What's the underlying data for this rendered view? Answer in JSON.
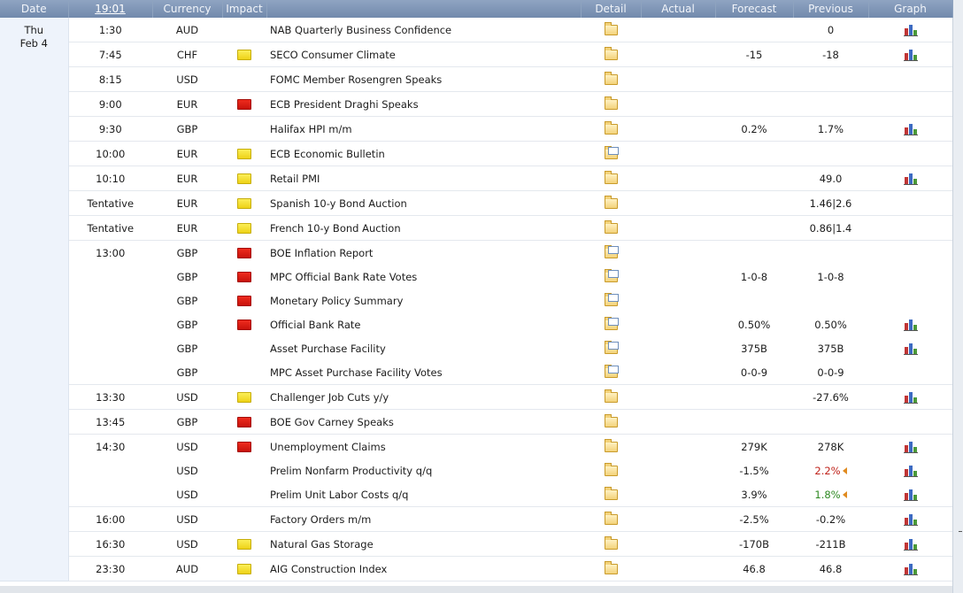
{
  "header": {
    "date": "Date",
    "time": "19:01",
    "currency": "Currency",
    "impact": "Impact",
    "event": "",
    "detail": "Detail",
    "actual": "Actual",
    "forecast": "Forecast",
    "previous": "Previous",
    "graph": "Graph"
  },
  "day": {
    "weekday": "Thu",
    "date": "Feb 4"
  },
  "colors": {
    "header_bg": "#7f95b6",
    "impact_high": "#dd1c12",
    "impact_medium": "#ee8a30",
    "impact_low": "#f5e03a",
    "prev_red": "#c0241c",
    "prev_green": "#2f8a23"
  },
  "rows": [
    {
      "time": "1:30",
      "currency": "AUD",
      "impact": "medium",
      "event": "NAB Quarterly Business Confidence",
      "detail_icon": "folder-icon",
      "actual": "",
      "forecast": "",
      "previous": "0",
      "previous_style": "",
      "graph": true,
      "group_end": true
    },
    {
      "time": "7:45",
      "currency": "CHF",
      "impact": "low",
      "event": "SECO Consumer Climate",
      "detail_icon": "folder-icon",
      "actual": "",
      "forecast": "-15",
      "previous": "-18",
      "previous_style": "",
      "graph": true,
      "group_end": true
    },
    {
      "time": "8:15",
      "currency": "USD",
      "impact": "medium",
      "event": "FOMC Member Rosengren Speaks",
      "detail_icon": "folder-icon",
      "actual": "",
      "forecast": "",
      "previous": "",
      "previous_style": "",
      "graph": false,
      "group_end": true
    },
    {
      "time": "9:00",
      "currency": "EUR",
      "impact": "high",
      "event": "ECB President Draghi Speaks",
      "detail_icon": "folder-icon",
      "actual": "",
      "forecast": "",
      "previous": "",
      "previous_style": "",
      "graph": false,
      "group_end": true
    },
    {
      "time": "9:30",
      "currency": "GBP",
      "impact": "medium",
      "event": "Halifax HPI m/m",
      "detail_icon": "folder-icon",
      "actual": "",
      "forecast": "0.2%",
      "previous": "1.7%",
      "previous_style": "",
      "graph": true,
      "group_end": true
    },
    {
      "time": "10:00",
      "currency": "EUR",
      "impact": "low",
      "event": "ECB Economic Bulletin",
      "detail_icon": "folder-doc-icon",
      "actual": "",
      "forecast": "",
      "previous": "",
      "previous_style": "",
      "graph": false,
      "group_end": true
    },
    {
      "time": "10:10",
      "currency": "EUR",
      "impact": "low",
      "event": "Retail PMI",
      "detail_icon": "folder-icon",
      "actual": "",
      "forecast": "",
      "previous": "49.0",
      "previous_style": "",
      "graph": true,
      "group_end": true
    },
    {
      "time": "Tentative",
      "currency": "EUR",
      "impact": "low",
      "event": "Spanish 10-y Bond Auction",
      "detail_icon": "folder-icon",
      "actual": "",
      "forecast": "",
      "previous": "1.46|2.6",
      "previous_style": "",
      "graph": false,
      "group_end": true
    },
    {
      "time": "Tentative",
      "currency": "EUR",
      "impact": "low",
      "event": "French 10-y Bond Auction",
      "detail_icon": "folder-icon",
      "actual": "",
      "forecast": "",
      "previous": "0.86|1.4",
      "previous_style": "",
      "graph": false,
      "group_end": true
    },
    {
      "time": "13:00",
      "currency": "GBP",
      "impact": "high",
      "event": "BOE Inflation Report",
      "detail_icon": "folder-doc-icon",
      "actual": "",
      "forecast": "",
      "previous": "",
      "previous_style": "",
      "graph": false,
      "group_end": false
    },
    {
      "time": "",
      "currency": "GBP",
      "impact": "high",
      "event": "MPC Official Bank Rate Votes",
      "detail_icon": "folder-doc-icon",
      "actual": "",
      "forecast": "1-0-8",
      "previous": "1-0-8",
      "previous_style": "",
      "graph": false,
      "group_end": false
    },
    {
      "time": "",
      "currency": "GBP",
      "impact": "high",
      "event": "Monetary Policy Summary",
      "detail_icon": "folder-doc-icon",
      "actual": "",
      "forecast": "",
      "previous": "",
      "previous_style": "",
      "graph": false,
      "group_end": false
    },
    {
      "time": "",
      "currency": "GBP",
      "impact": "high",
      "event": "Official Bank Rate",
      "detail_icon": "folder-doc-icon",
      "actual": "",
      "forecast": "0.50%",
      "previous": "0.50%",
      "previous_style": "",
      "graph": true,
      "group_end": false
    },
    {
      "time": "",
      "currency": "GBP",
      "impact": "medium",
      "event": "Asset Purchase Facility",
      "detail_icon": "folder-doc-icon",
      "actual": "",
      "forecast": "375B",
      "previous": "375B",
      "previous_style": "",
      "graph": true,
      "group_end": false
    },
    {
      "time": "",
      "currency": "GBP",
      "impact": "medium",
      "event": "MPC Asset Purchase Facility Votes",
      "detail_icon": "folder-doc-icon",
      "actual": "",
      "forecast": "0-0-9",
      "previous": "0-0-9",
      "previous_style": "",
      "graph": false,
      "group_end": true
    },
    {
      "time": "13:30",
      "currency": "USD",
      "impact": "low",
      "event": "Challenger Job Cuts y/y",
      "detail_icon": "folder-icon",
      "actual": "",
      "forecast": "",
      "previous": "-27.6%",
      "previous_style": "",
      "graph": true,
      "group_end": true
    },
    {
      "time": "13:45",
      "currency": "GBP",
      "impact": "high",
      "event": "BOE Gov Carney Speaks",
      "detail_icon": "folder-icon",
      "actual": "",
      "forecast": "",
      "previous": "",
      "previous_style": "",
      "graph": false,
      "group_end": true
    },
    {
      "time": "14:30",
      "currency": "USD",
      "impact": "high",
      "event": "Unemployment Claims",
      "detail_icon": "folder-icon",
      "actual": "",
      "forecast": "279K",
      "previous": "278K",
      "previous_style": "",
      "graph": true,
      "group_end": false
    },
    {
      "time": "",
      "currency": "USD",
      "impact": "medium",
      "event": "Prelim Nonfarm Productivity q/q",
      "detail_icon": "folder-icon",
      "actual": "",
      "forecast": "-1.5%",
      "previous": "2.2%",
      "previous_style": "red",
      "graph": true,
      "group_end": false
    },
    {
      "time": "",
      "currency": "USD",
      "impact": "medium",
      "event": "Prelim Unit Labor Costs q/q",
      "detail_icon": "folder-icon",
      "actual": "",
      "forecast": "3.9%",
      "previous": "1.8%",
      "previous_style": "green",
      "graph": true,
      "group_end": true
    },
    {
      "time": "16:00",
      "currency": "USD",
      "impact": "medium",
      "event": "Factory Orders m/m",
      "detail_icon": "folder-icon",
      "actual": "",
      "forecast": "-2.5%",
      "previous": "-0.2%",
      "previous_style": "",
      "graph": true,
      "group_end": true
    },
    {
      "time": "16:30",
      "currency": "USD",
      "impact": "low",
      "event": "Natural Gas Storage",
      "detail_icon": "folder-icon",
      "actual": "",
      "forecast": "-170B",
      "previous": "-211B",
      "previous_style": "",
      "graph": true,
      "group_end": true
    },
    {
      "time": "23:30",
      "currency": "AUD",
      "impact": "low",
      "event": "AIG Construction Index",
      "detail_icon": "folder-icon",
      "actual": "",
      "forecast": "46.8",
      "previous": "46.8",
      "previous_style": "",
      "graph": true,
      "group_end": true
    }
  ]
}
